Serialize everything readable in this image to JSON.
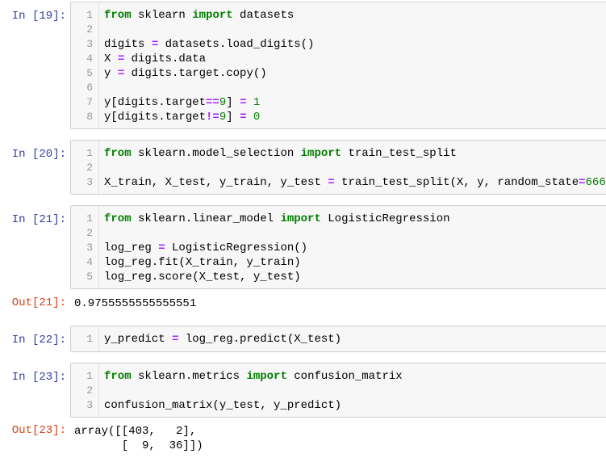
{
  "cells": [
    {
      "prompt": "In [19]:",
      "lines": [
        {
          "n": "1",
          "tokens": [
            {
              "t": "from",
              "c": "kw"
            },
            {
              "t": " sklearn ",
              "c": ""
            },
            {
              "t": "import",
              "c": "kw"
            },
            {
              "t": " datasets",
              "c": ""
            }
          ]
        },
        {
          "n": "2",
          "tokens": []
        },
        {
          "n": "3",
          "tokens": [
            {
              "t": "digits ",
              "c": ""
            },
            {
              "t": "=",
              "c": "op"
            },
            {
              "t": " datasets.load_digits()",
              "c": ""
            }
          ]
        },
        {
          "n": "4",
          "tokens": [
            {
              "t": "X ",
              "c": ""
            },
            {
              "t": "=",
              "c": "op"
            },
            {
              "t": " digits.data",
              "c": ""
            }
          ]
        },
        {
          "n": "5",
          "tokens": [
            {
              "t": "y ",
              "c": ""
            },
            {
              "t": "=",
              "c": "op"
            },
            {
              "t": " digits.target.copy()",
              "c": ""
            }
          ]
        },
        {
          "n": "6",
          "tokens": []
        },
        {
          "n": "7",
          "tokens": [
            {
              "t": "y[digits.target",
              "c": ""
            },
            {
              "t": "==",
              "c": "op"
            },
            {
              "t": "9",
              "c": "num"
            },
            {
              "t": "] ",
              "c": ""
            },
            {
              "t": "=",
              "c": "op"
            },
            {
              "t": " ",
              "c": ""
            },
            {
              "t": "1",
              "c": "num"
            }
          ]
        },
        {
          "n": "8",
          "tokens": [
            {
              "t": "y[digits.target",
              "c": ""
            },
            {
              "t": "!=",
              "c": "op"
            },
            {
              "t": "9",
              "c": "num"
            },
            {
              "t": "] ",
              "c": ""
            },
            {
              "t": "=",
              "c": "op"
            },
            {
              "t": " ",
              "c": ""
            },
            {
              "t": "0",
              "c": "num"
            }
          ]
        }
      ]
    },
    {
      "prompt": "In [20]:",
      "lines": [
        {
          "n": "1",
          "tokens": [
            {
              "t": "from",
              "c": "kw"
            },
            {
              "t": " sklearn.model_selection ",
              "c": ""
            },
            {
              "t": "import",
              "c": "kw"
            },
            {
              "t": " train_test_split",
              "c": ""
            }
          ]
        },
        {
          "n": "2",
          "tokens": []
        },
        {
          "n": "3",
          "tokens": [
            {
              "t": "X_train, X_test, y_train, y_test ",
              "c": ""
            },
            {
              "t": "=",
              "c": "op"
            },
            {
              "t": " train_test_split(X, y, random_state",
              "c": ""
            },
            {
              "t": "=",
              "c": "op"
            },
            {
              "t": "666",
              "c": "num"
            },
            {
              "t": ")",
              "c": ""
            }
          ]
        }
      ]
    },
    {
      "prompt": "In [21]:",
      "lines": [
        {
          "n": "1",
          "tokens": [
            {
              "t": "from",
              "c": "kw"
            },
            {
              "t": " sklearn.linear_model ",
              "c": ""
            },
            {
              "t": "import",
              "c": "kw"
            },
            {
              "t": " LogisticRegression",
              "c": ""
            }
          ]
        },
        {
          "n": "2",
          "tokens": []
        },
        {
          "n": "3",
          "tokens": [
            {
              "t": "log_reg ",
              "c": ""
            },
            {
              "t": "=",
              "c": "op"
            },
            {
              "t": " LogisticRegression()",
              "c": ""
            }
          ]
        },
        {
          "n": "4",
          "tokens": [
            {
              "t": "log_reg.fit(X_train, y_train)",
              "c": ""
            }
          ]
        },
        {
          "n": "5",
          "tokens": [
            {
              "t": "log_reg.score(X_test, y_test)",
              "c": ""
            }
          ]
        }
      ],
      "out_prompt": "Out[21]:",
      "output": "0.9755555555555551"
    },
    {
      "prompt": "In [22]:",
      "lines": [
        {
          "n": "1",
          "tokens": [
            {
              "t": "y_predict ",
              "c": ""
            },
            {
              "t": "=",
              "c": "op"
            },
            {
              "t": " log_reg.predict(X_test)",
              "c": ""
            }
          ]
        }
      ]
    },
    {
      "prompt": "In [23]:",
      "lines": [
        {
          "n": "1",
          "tokens": [
            {
              "t": "from",
              "c": "kw"
            },
            {
              "t": " sklearn.metrics ",
              "c": ""
            },
            {
              "t": "import",
              "c": "kw"
            },
            {
              "t": " confusion_matrix",
              "c": ""
            }
          ]
        },
        {
          "n": "2",
          "tokens": []
        },
        {
          "n": "3",
          "tokens": [
            {
              "t": "confusion_matrix(y_test, y_predict)",
              "c": ""
            }
          ]
        }
      ],
      "out_prompt": "Out[23]:",
      "output": "array([[403,   2],\n       [  9,  36]])"
    }
  ],
  "colors": {
    "prompt_in": "#303f9f",
    "prompt_out": "#d84315",
    "keyword": "#008000",
    "operator": "#aa22ff",
    "number": "#008000"
  }
}
